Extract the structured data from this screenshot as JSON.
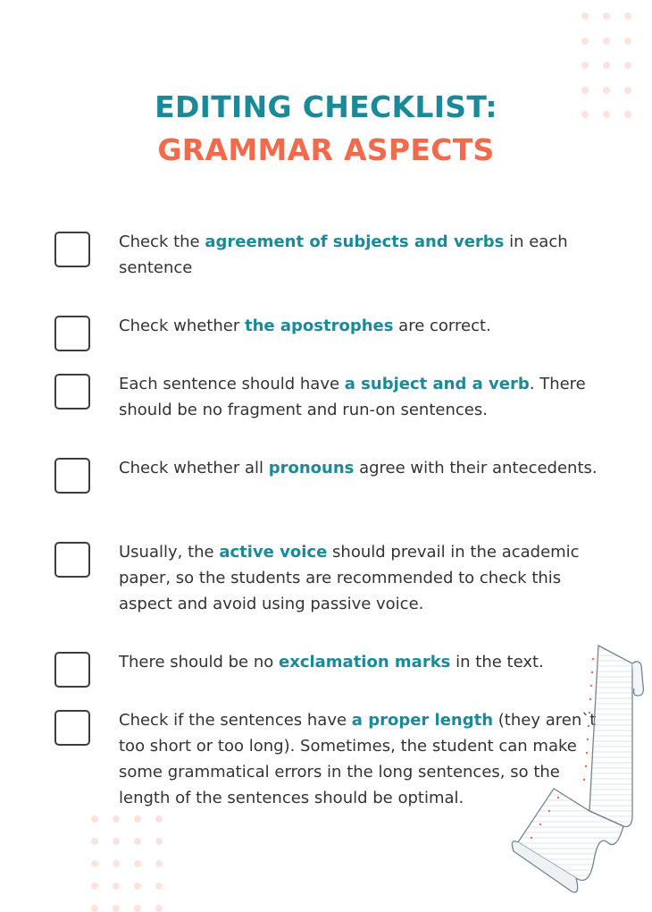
{
  "title": {
    "line1": "EDITING CHECKLIST:",
    "line2": "GRAMMAR ASPECTS"
  },
  "colors": {
    "accent_teal": "#1a8a9a",
    "accent_orange": "#f26a4b",
    "text": "#333333",
    "dots": "#fde3dc"
  },
  "items": [
    {
      "checked": false,
      "before": "Check the ",
      "highlight": "agreement of subjects and verbs",
      "after": " in each sentence"
    },
    {
      "checked": false,
      "before": "Check whether ",
      "highlight": "the apostrophes",
      "after": " are correct."
    },
    {
      "checked": false,
      "before": "Each sentence should have ",
      "highlight": "a subject and a verb",
      "after": ". There should be no fragment and run-on sentences."
    },
    {
      "checked": false,
      "before": "Check whether all ",
      "highlight": "pronouns",
      "after": " agree with their antecedents."
    },
    {
      "checked": false,
      "before": "Usually, the ",
      "highlight": "active voice",
      "after": " should prevail in the academic paper, so the students are recommended to check this aspect and avoid using passive voice."
    },
    {
      "checked": false,
      "before": "There should be no ",
      "highlight": "exclamation marks",
      "after": " in the text."
    },
    {
      "checked": false,
      "before": "Check if the sentences have ",
      "highlight": "a proper length",
      "after": " (they aren`t too short or too long). Sometimes, the student can make some grammatical errors in the long sentences, so the length of the sentences should be optimal."
    }
  ],
  "decorations": {
    "top_right": "dot-grid",
    "bottom_left": "dot-grid",
    "bottom_right": "paper-scroll-illustration"
  }
}
